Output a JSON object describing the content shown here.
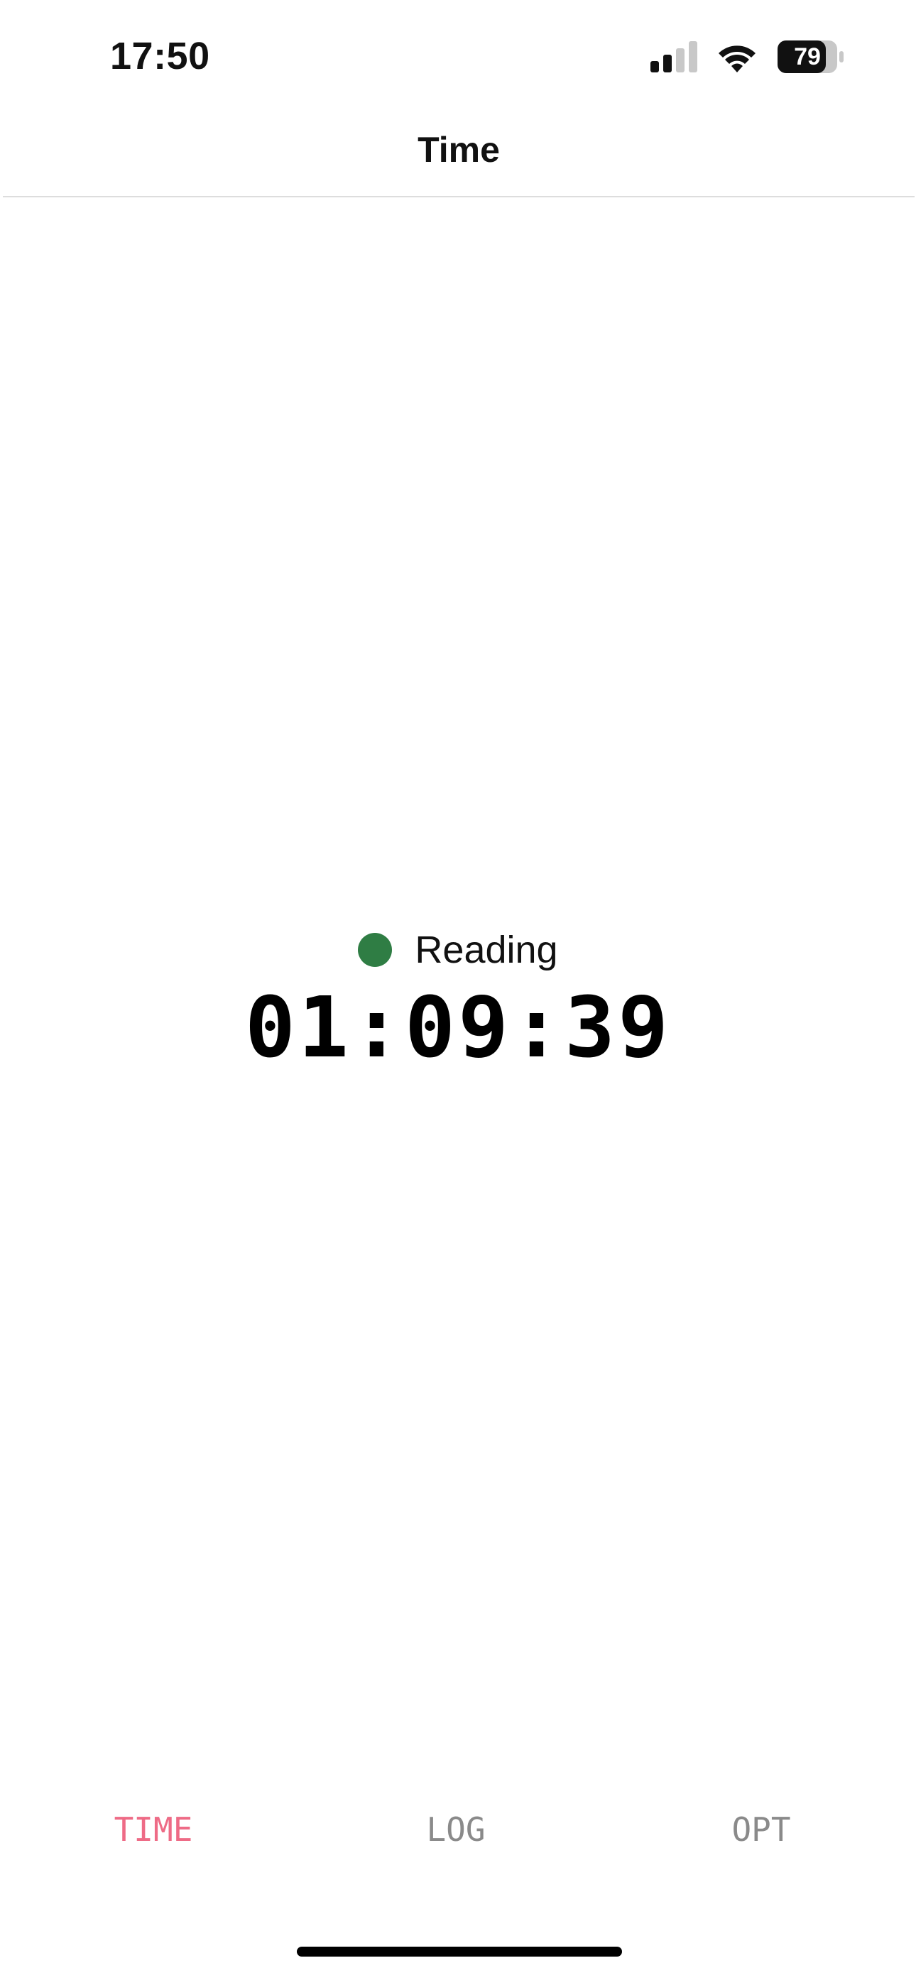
{
  "status_bar": {
    "time": "17:50",
    "battery": "79",
    "icons": [
      "signal-icon",
      "wifi-icon",
      "battery-icon"
    ]
  },
  "header": {
    "title": "Time"
  },
  "activity": {
    "label": "Reading",
    "dot_color": "#2f7d44"
  },
  "timer": {
    "value": "01:09:39"
  },
  "tabs": [
    {
      "label": "TIME",
      "active": true
    },
    {
      "label": "LOG",
      "active": false
    },
    {
      "label": "OPT",
      "active": false
    }
  ],
  "colors": {
    "accent": "#ee6b86",
    "inactive_tab": "#8a8a8a"
  }
}
